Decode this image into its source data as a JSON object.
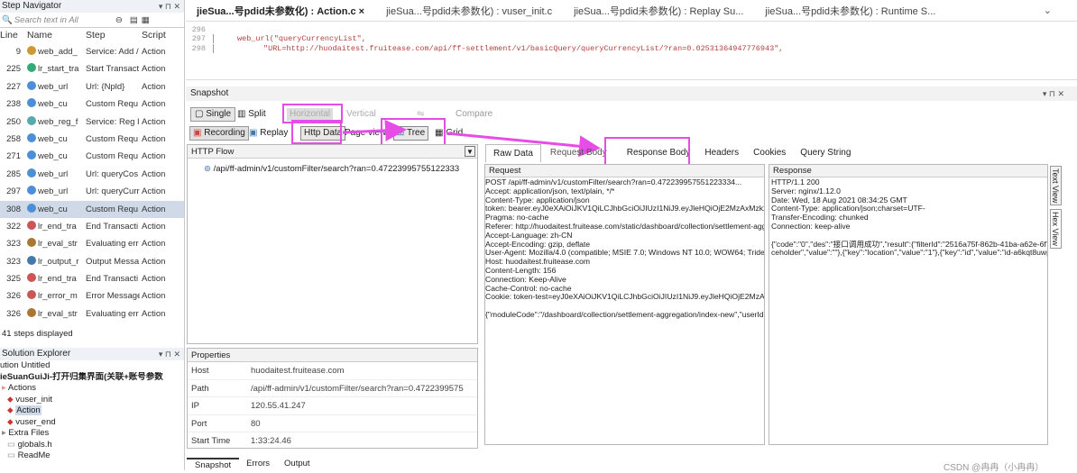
{
  "step_navigator": {
    "title": "Step Navigator",
    "title_btns": "▾ ⊓ ✕",
    "search_placeholder": "Search text in All",
    "columns": [
      "Line",
      "Name",
      "Step",
      "Script"
    ],
    "rows": [
      {
        "line": "9",
        "name": "web_add_",
        "step": "Service: Add /",
        "script": "Action",
        "color": "#c93"
      },
      {
        "line": "225",
        "name": "lr_start_tra",
        "step": "Start Transact",
        "script": "Action",
        "color": "#3a7"
      },
      {
        "line": "227",
        "name": "web_url",
        "step": "Url: {Npld}",
        "script": "Action",
        "color": "#4a8fd8"
      },
      {
        "line": "238",
        "name": "web_cu",
        "step": "Custom Requ",
        "script": "Action",
        "color": "#4a8fd8"
      },
      {
        "line": "250",
        "name": "web_reg_f",
        "step": "Service: Reg I",
        "script": "Action",
        "color": "#5aa"
      },
      {
        "line": "258",
        "name": "web_cu",
        "step": "Custom Requ",
        "script": "Action",
        "color": "#4a8fd8"
      },
      {
        "line": "271",
        "name": "web_cu",
        "step": "Custom Requ",
        "script": "Action",
        "color": "#4a8fd8"
      },
      {
        "line": "285",
        "name": "web_url",
        "step": "Url: queryCos",
        "script": "Action",
        "color": "#4a8fd8"
      },
      {
        "line": "297",
        "name": "web_url",
        "step": "Url: queryCurr",
        "script": "Action",
        "color": "#4a8fd8"
      },
      {
        "line": "308",
        "name": "web_cu",
        "step": "Custom Requ",
        "script": "Action",
        "color": "#4a8fd8",
        "selected": true
      },
      {
        "line": "322",
        "name": "lr_end_tra",
        "step": "End Transacti",
        "script": "Action",
        "color": "#c55"
      },
      {
        "line": "323",
        "name": "lr_eval_str",
        "step": "Evaluating err",
        "script": "Action",
        "color": "#a73"
      },
      {
        "line": "323",
        "name": "lr_output_r",
        "step": "Output Messa",
        "script": "Action",
        "color": "#47a"
      },
      {
        "line": "325",
        "name": "lr_end_tra",
        "step": "End Transacti",
        "script": "Action",
        "color": "#c55"
      },
      {
        "line": "326",
        "name": "lr_error_m",
        "step": "Error Message",
        "script": "Action",
        "color": "#c55"
      },
      {
        "line": "326",
        "name": "lr_eval_str",
        "step": "Evaluating err",
        "script": "Action",
        "color": "#a73"
      }
    ],
    "steps_displayed": "41 steps displayed"
  },
  "solution_explorer": {
    "title": "Solution Explorer",
    "items": [
      "ution Untitled",
      "ieSuanGuiJi-打开归集界面(关联+账号参数",
      "Actions",
      "vuser_init",
      "Action",
      "vuser_end",
      "Extra Files",
      "globals.h",
      "ReadMe"
    ]
  },
  "editor": {
    "tabs": [
      "jieSua...号pdid未参数化) : Action.c ×",
      "jieSua...号pdid未参数化) : vuser_init.c",
      "jieSua...号pdid未参数化) : Replay Su...",
      "jieSua...号pdid未参数化) : Runtime S..."
    ],
    "overflow": "⌄",
    "lines": [
      {
        "n": "296",
        "t": ""
      },
      {
        "n": "297",
        "t": "web_url(\"queryCurrencyList\","
      },
      {
        "n": "298",
        "t": "\"URL=http://huodaitest.fruitease.com/api/ff-settlement/v1/basicQuery/queryCurrencyList/?ran=0.02531364947776943\","
      }
    ]
  },
  "snapshot": {
    "title": "Snapshot",
    "single": "Single",
    "split": "Split",
    "horizontal": "Horizontal",
    "vertical": "Vertical",
    "compare": "Compare",
    "recording": "Recording",
    "replay": "Replay",
    "http_data": "Http Data",
    "page_view": "Page view",
    "tree": "Tree",
    "grid": "Grid",
    "http_flow_title": "HTTP Flow",
    "flow_item": "/api/ff-admin/v1/customFilter/search?ran=0.47223995755122333",
    "tabs": [
      "Raw Data",
      "Request Body",
      "Response Body",
      "Headers",
      "Cookies",
      "Query String"
    ],
    "request_title": "Request",
    "request_lines": [
      "POST /api/ff-admin/v1/customFilter/search?ran=0.472239957551223334...",
      "Accept: application/json, text/plain, */*",
      "Content-Type: application/json",
      "token: bearer.eyJ0eXAiOiJKV1QiLCJhbGciOiJIUzI1NiJ9.eyJleHQiOjE2MzAxMzk2M",
      "Pragma: no-cache",
      "Referer: http://huodaitest.fruitease.com/static/dashboard/collection/settlement-aggre",
      "Accept-Language: zh-CN",
      "Accept-Encoding: gzip, deflate",
      "User-Agent: Mozilla/4.0 (compatible; MSIE 7.0; Windows NT 10.0; WOW64; Tride",
      "Host: huodaitest.fruitease.com",
      "Content-Length: 156",
      "Connection: Keep-Alive",
      "Cache-Control: no-cache",
      "Cookie: token-test=eyJ0eXAiOiJKV1QiLCJhbGciOiJIUzI1NiJ9.eyJleHQiOjE2MzAxM",
      "",
      "{\"moduleCode\":\"/dashboard/collection/settlement-aggregation/index-new\",\"userId\":\"0"
    ],
    "response_title": "Response",
    "response_lines": [
      "HTTP/1.1 200",
      "Server: nginx/1.12.0",
      "Date: Wed, 18 Aug 2021 08:34:25 GMT",
      "Content-Type: application/json;charset=UTF-",
      "Transfer-Encoding: chunked",
      "Connection: keep-alive",
      "",
      "{\"code\":\"0\",\"des\":\"接口调用成功\",\"result\":{\"filterId\":\"2516a75f-862b-41ba-a62e-6f7f6",
      "ceholder\",\"value\":\"\"},{\"key\":\"location\",\"value\":\"1\"},{\"key\":\"id\",\"value\":\"id-a6kqt8uwpo"
    ],
    "side_tabs": [
      "Text View",
      "Hex View"
    ]
  },
  "properties": {
    "title": "Properties",
    "rows": [
      {
        "k": "Host",
        "v": "huodaitest.fruitease.com"
      },
      {
        "k": "Path",
        "v": "/api/ff-admin/v1/customFilter/search?ran=0.4722399575"
      },
      {
        "k": "IP",
        "v": "120.55.41.247"
      },
      {
        "k": "Port",
        "v": "80"
      },
      {
        "k": "Start Time",
        "v": "1:33:24.46"
      }
    ]
  },
  "bottom_tabs": [
    "Snapshot",
    "Errors",
    "Output"
  ],
  "watermark": "CSDN @冉冉（小冉冉）"
}
